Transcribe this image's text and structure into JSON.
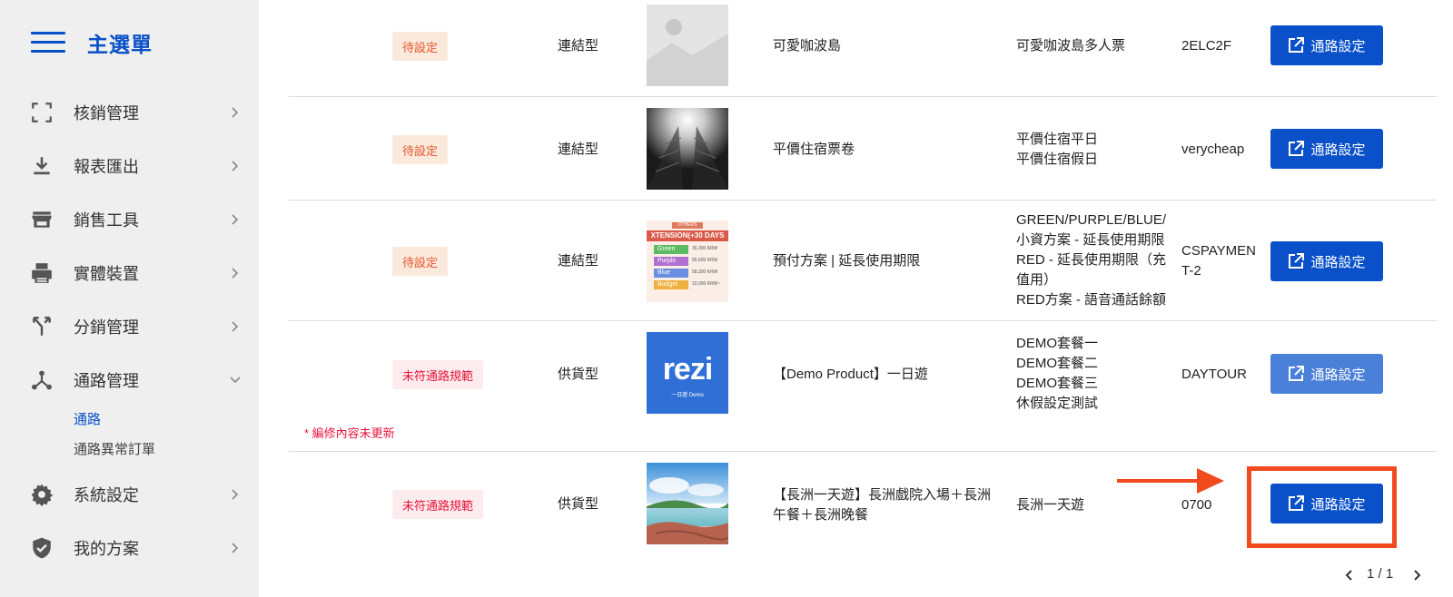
{
  "sidebar": {
    "title": "主選單",
    "items": [
      {
        "label": "核銷管理",
        "icon": "scan-frame-icon"
      },
      {
        "label": "報表匯出",
        "icon": "download-icon"
      },
      {
        "label": "銷售工具",
        "icon": "store-icon"
      },
      {
        "label": "實體裝置",
        "icon": "printer-icon"
      },
      {
        "label": "分銷管理",
        "icon": "fork-icon"
      },
      {
        "label": "通路管理",
        "icon": "network-icon",
        "expanded": true,
        "children": [
          {
            "label": "通路",
            "active": true
          },
          {
            "label": "通路異常訂單"
          }
        ]
      },
      {
        "label": "系統設定",
        "icon": "gear-icon"
      },
      {
        "label": "我的方案",
        "icon": "shield-check-icon"
      }
    ]
  },
  "rows": [
    {
      "status": "待設定",
      "type": "連結型",
      "image": "placeholder-image",
      "product": "可愛咖波島",
      "packages": [
        "可愛咖波島多人票"
      ],
      "code": "2ELC2F",
      "button": "通路設定"
    },
    {
      "status": "待設定",
      "type": "連結型",
      "image": "building-photo",
      "product": "平價住宿票卷",
      "packages": [
        "平價住宿平日",
        "平價住宿假日"
      ],
      "code": "verycheap",
      "button": "通路設定"
    },
    {
      "status": "待設定",
      "type": "連結型",
      "image": "extension-plan-image",
      "product": "預付方案 | 延長使用期限",
      "packages": [
        "GREEN/PURPLE/BLUE/",
        "小資方案 - 延長使用期限",
        "RED - 延長使用期限（充",
        "值用）",
        "RED方案 - 語音通話餘額"
      ],
      "code": [
        "CSPAYMEN",
        "T-2"
      ],
      "button": "通路設定"
    },
    {
      "status": "未符通路規範",
      "type": "供貨型",
      "image": "rezio-demo-image",
      "product": "【Demo Product】一日遊",
      "packages": [
        "DEMO套餐一",
        "DEMO套餐二",
        "DEMO套餐三",
        "休假設定測試"
      ],
      "code": "DAYTOUR",
      "button": "通路設定",
      "note": "* 編修內容未更新"
    },
    {
      "status": "未符通路規範",
      "type": "供貨型",
      "image": "beach-photo",
      "product": [
        "【長洲一天遊】長洲戲院入場＋長洲",
        "午餐＋長洲晚餐"
      ],
      "packages": [
        "長洲一天遊"
      ],
      "code": "0700",
      "button": "通路設定",
      "highlighted": true
    }
  ],
  "image_texts": {
    "extension_header": "OTHERS",
    "extension_title": "XTENSION(+30 DAYS",
    "extension_tiers": [
      {
        "name": "Green",
        "price": "36,300 KRW"
      },
      {
        "name": "Purple",
        "price": "55,600 KRW"
      },
      {
        "name": "Blue",
        "price": "58,300 KRW"
      },
      {
        "name": "Budget",
        "price": "10,000 KRW~"
      }
    ],
    "rezio_logo": "rezi",
    "rezio_sub": "一日遊 Demo"
  },
  "pagination": {
    "label": "1 / 1"
  },
  "colors": {
    "primary": "#0a50c8",
    "annotation": "#f04a1e",
    "pending_tag_bg": "#fbe9dc",
    "invalid_tag_bg": "#fdecee"
  }
}
